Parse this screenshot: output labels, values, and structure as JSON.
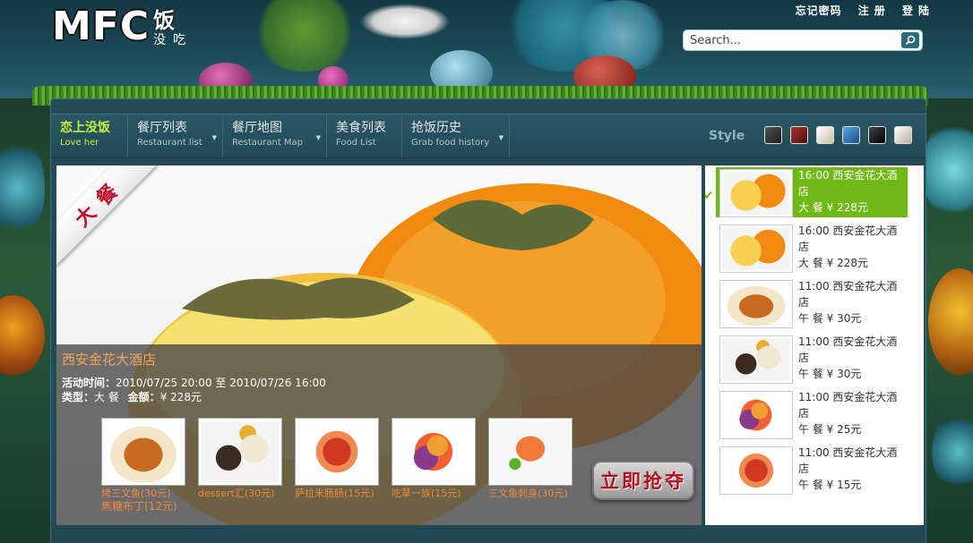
{
  "header": {
    "logo": {
      "main": "MFC",
      "fan": "饭",
      "sub": "没吃"
    },
    "links": [
      "忘记密码",
      "注 册",
      "登 陆"
    ],
    "search": {
      "placeholder": "Search..."
    }
  },
  "nav": {
    "items": [
      {
        "zh": "恋上没饭",
        "en": "Love her",
        "active": true
      },
      {
        "zh": "餐厅列表",
        "en": "Restaurant list",
        "active": false
      },
      {
        "zh": "餐厅地图",
        "en": "Restaurant Map",
        "active": false
      },
      {
        "zh": "美食列表",
        "en": "Food List",
        "active": false
      },
      {
        "zh": "抢饭历史",
        "en": "Grab food history",
        "active": false
      }
    ],
    "style_label": "Style",
    "swatch_colors": [
      "#3a3a3a",
      "#7a1b1b",
      "#e8dcc4",
      "#2a6fb0",
      "#222222",
      "#d8d2c4"
    ]
  },
  "feature": {
    "ribbon": "大 餐",
    "title": "西安金花大酒店",
    "time_label": "活动时间：",
    "time_value": "2010/07/25 20:00 至 2010/07/26 16:00",
    "type_label": "类型：",
    "type_value": "大 餐",
    "amount_label": "金额：",
    "amount_value": "¥ 228元",
    "dishes": [
      {
        "line1": "烤三文鱼(30元)",
        "line2": "焦糖布丁(12元)"
      },
      {
        "line1": "dessert汇(30元)",
        "line2": ""
      },
      {
        "line1": "萨拉米肠肠(15元)",
        "line2": ""
      },
      {
        "line1": "吃草一族(15元)",
        "line2": ""
      },
      {
        "line1": "三文鱼刺身(30元)",
        "line2": ""
      }
    ],
    "grab_button": "立即抢夺"
  },
  "side_list": [
    {
      "line1": "16:00 西安金花大酒店",
      "line2": "大 餐 ¥ 228元",
      "selected": true
    },
    {
      "line1": "16:00 西安金花大酒店",
      "line2": "大 餐 ¥ 228元",
      "selected": false
    },
    {
      "line1": "11:00 西安金花大酒店",
      "line2": "午 餐 ¥ 30元",
      "selected": false
    },
    {
      "line1": "11:00 西安金花大酒店",
      "line2": "午 餐 ¥ 30元",
      "selected": false
    },
    {
      "line1": "11:00 西安金花大酒店",
      "line2": "午 餐 ¥ 25元",
      "selected": false
    },
    {
      "line1": "11:00 西安金花大酒店",
      "line2": "午 餐 ¥ 15元",
      "selected": false
    }
  ]
}
